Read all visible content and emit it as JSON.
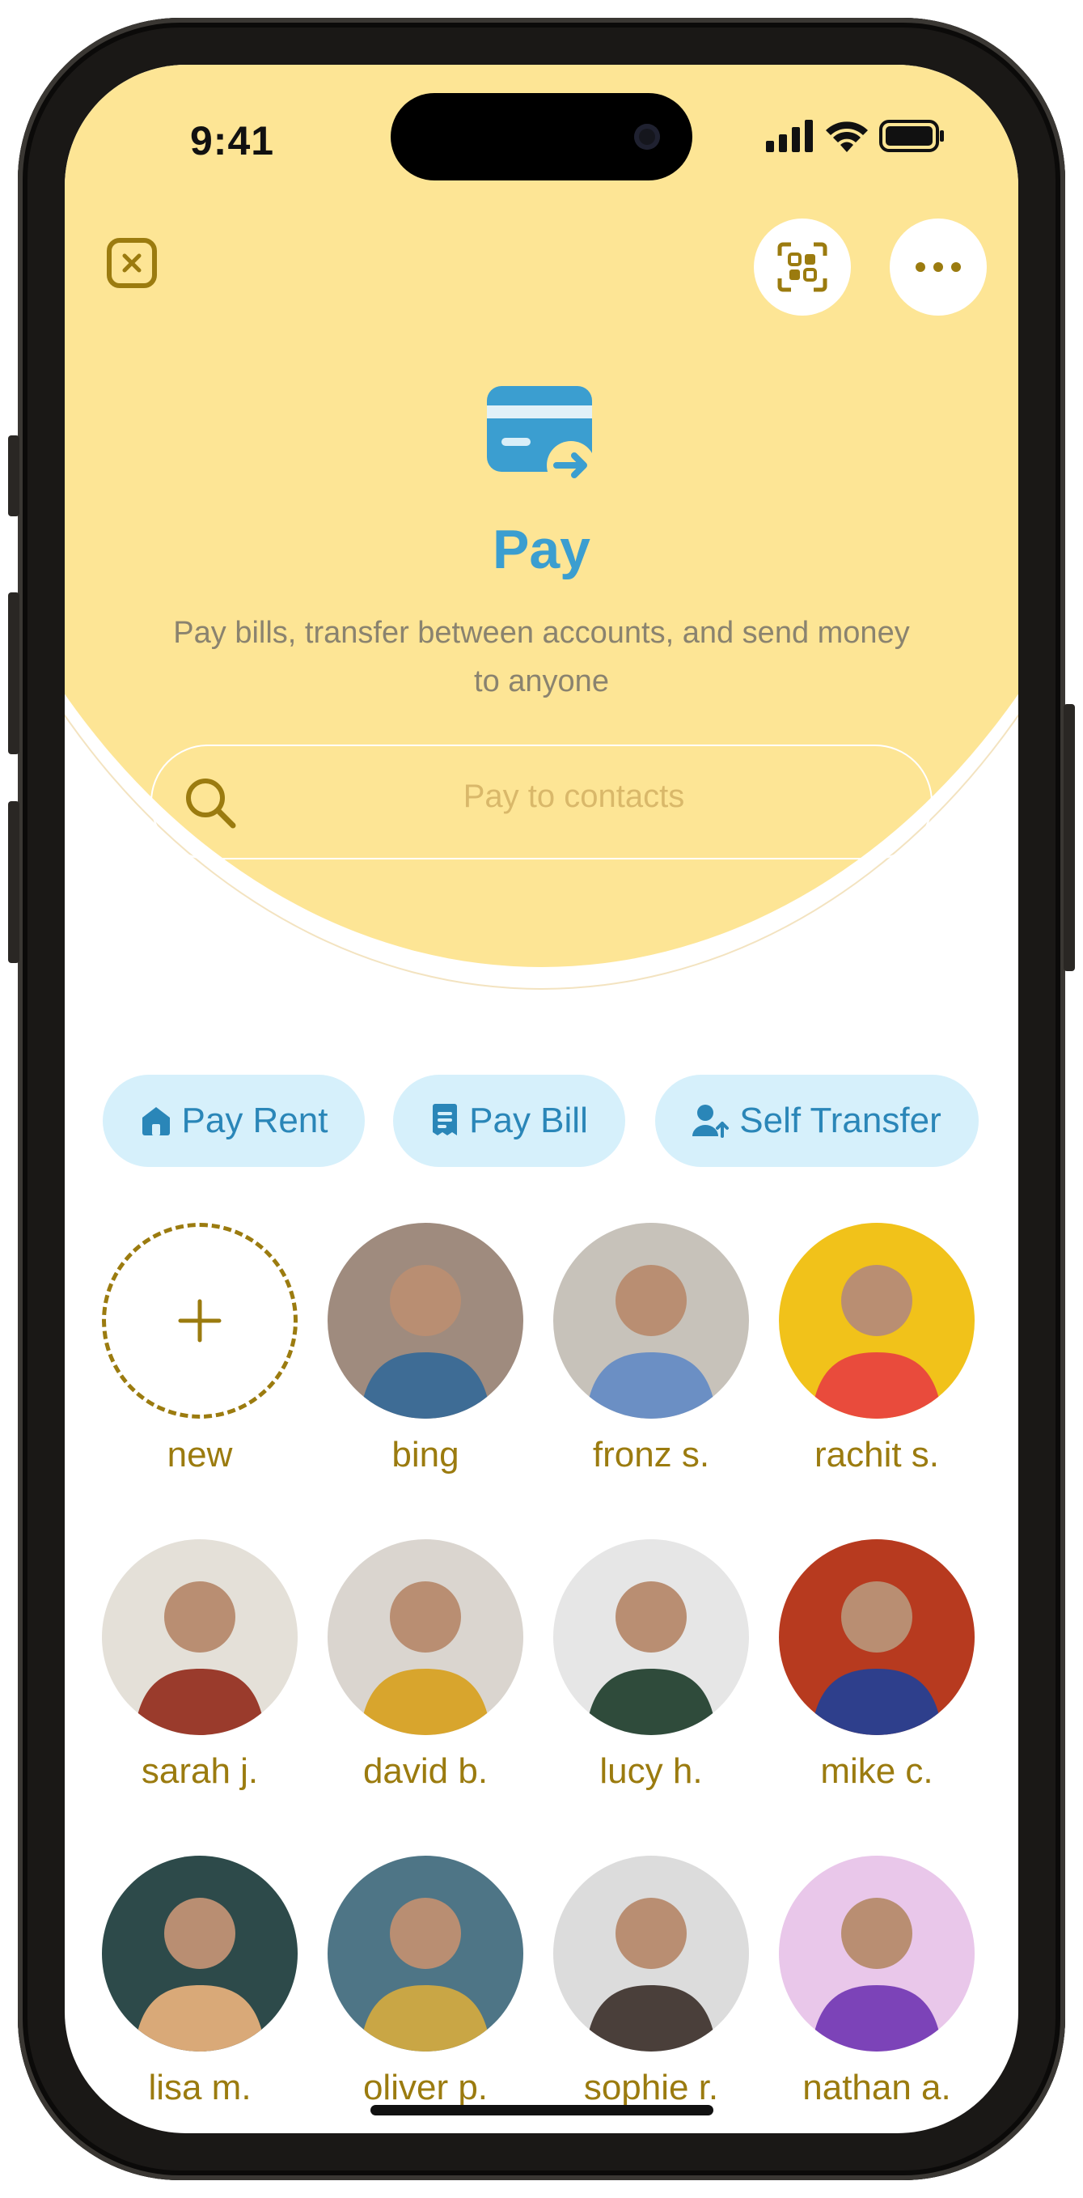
{
  "status": {
    "time": "9:41"
  },
  "header": {
    "title": "Pay",
    "subtitle": "Pay bills, transfer between accounts, and send money to anyone"
  },
  "search": {
    "placeholder": "Pay to contacts"
  },
  "quick_actions": [
    {
      "label": "Pay Rent",
      "icon": "home-icon"
    },
    {
      "label": "Pay Bill",
      "icon": "receipt-icon"
    },
    {
      "label": "Self Transfer",
      "icon": "user-transfer-icon"
    }
  ],
  "contacts": [
    {
      "name": "new",
      "type": "add",
      "icon": "plus-icon"
    },
    {
      "name": "bing",
      "bg": "#9f8b7e",
      "fg": "#3e6c95"
    },
    {
      "name": "fronz s.",
      "bg": "#c7c2ba",
      "fg": "#6b8fc4"
    },
    {
      "name": "rachit s.",
      "bg": "#f1c21a",
      "fg": "#e94b3c"
    },
    {
      "name": "sarah j.",
      "bg": "#e4e0d8",
      "fg": "#9a3b2c"
    },
    {
      "name": "david b.",
      "bg": "#dad5cf",
      "fg": "#d8a52d"
    },
    {
      "name": "lucy h.",
      "bg": "#e6e6e6",
      "fg": "#2f4b3b"
    },
    {
      "name": "mike c.",
      "bg": "#b73a1f",
      "fg": "#2e3f8c"
    },
    {
      "name": "lisa m.",
      "bg": "#2d4a4a",
      "fg": "#d9a978"
    },
    {
      "name": "oliver p.",
      "bg": "#4e7586",
      "fg": "#c9a645"
    },
    {
      "name": "sophie r.",
      "bg": "#dcdcdc",
      "fg": "#4a3f3a"
    },
    {
      "name": "nathan a.",
      "bg": "#e9c7ea",
      "fg": "#7c43b8"
    }
  ],
  "colors": {
    "header_bg": "#fde595",
    "accent_blue": "#3b9ed0",
    "accent_gold": "#9b7b0f",
    "chip_bg": "#d6f0fb"
  }
}
